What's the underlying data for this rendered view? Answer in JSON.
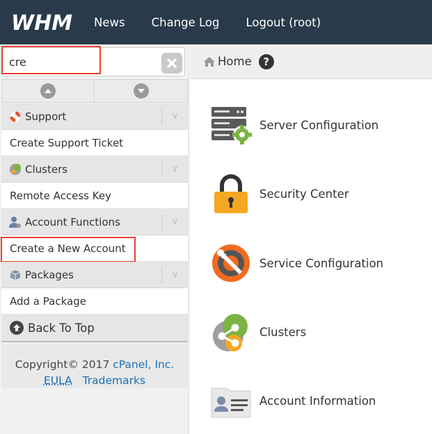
{
  "app": {
    "logo_text": "WHM"
  },
  "nav": {
    "items": [
      "News",
      "Change Log",
      "Logout (root)"
    ]
  },
  "search": {
    "value": "cre",
    "placeholder": ""
  },
  "sidebar": {
    "sections": [
      {
        "title": "Support",
        "icon": "lifebuoy-icon",
        "items": [
          "Create Support Ticket"
        ]
      },
      {
        "title": "Clusters",
        "icon": "clusters-icon",
        "items": [
          "Remote Access Key"
        ]
      },
      {
        "title": "Account Functions",
        "icon": "account-functions-icon",
        "items": [
          "Create a New Account"
        ]
      },
      {
        "title": "Packages",
        "icon": "package-icon",
        "items": [
          "Add a Package"
        ]
      }
    ],
    "back_to_top": "Back To Top"
  },
  "footer": {
    "copyright_prefix": "Copyright© 2017 ",
    "company": "cPanel, Inc.",
    "eula": "EULA",
    "trademarks": "Trademarks"
  },
  "breadcrumb": {
    "home": "Home",
    "help": "?"
  },
  "main": {
    "items": [
      {
        "label": "Server Configuration",
        "icon": "server-gear-icon"
      },
      {
        "label": "Security Center",
        "icon": "padlock-icon"
      },
      {
        "label": "Service Configuration",
        "icon": "wrench-gear-icon"
      },
      {
        "label": "Clusters",
        "icon": "clusters-share-icon"
      },
      {
        "label": "Account Information",
        "icon": "id-card-icon"
      }
    ]
  },
  "colors": {
    "topbar": "#293a4a",
    "highlight": "#e8412f",
    "link": "#1a6fb5",
    "accent_orange": "#f26b21",
    "accent_green": "#7cb342"
  }
}
